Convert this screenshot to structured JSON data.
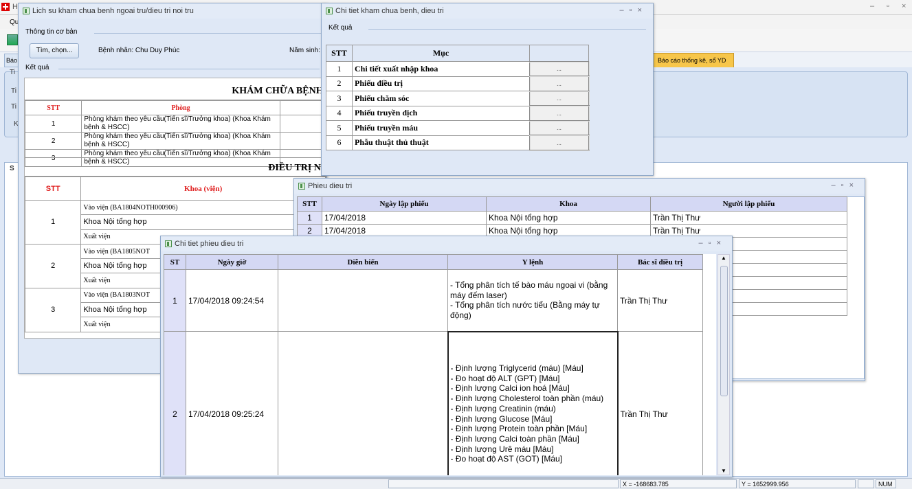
{
  "app": {
    "title_partial": "H",
    "menu_partial": "Qu",
    "window_controls": [
      "–",
      "▫",
      "×"
    ],
    "tab_left_partial": "Báo",
    "tab_baocao": "Báo cáo thống kê, sổ YD",
    "left_labels": [
      "Ti",
      "Ti",
      "Ti",
      "K",
      "S"
    ]
  },
  "status": {
    "x": "X = -168683.785",
    "y": "Y = 1652999.956",
    "num": "NUM"
  },
  "w1": {
    "title": "Lich su kham chua benh ngoai tru/dieu tri noi tru",
    "basic_label": "Thông tin cơ bản",
    "find_button": "Tìm, chọn...",
    "patient": "Bệnh nhân: Chu Duy Phúc",
    "dob_label": "Năm sinh:",
    "result_label": "Kết quả",
    "sec1": "KHÁM CHỮA BỆNH NGO",
    "sec1_headers": [
      "STT",
      "Phòng"
    ],
    "sec1_rows": [
      {
        "stt": "1",
        "room": "Phòng khám theo yêu cầu(Tiến sĩ/Trưởng khoa)  (Khoa Khám bệnh & HSCC)"
      },
      {
        "stt": "2",
        "room": "Phòng khám theo yêu cầu(Tiến sĩ/Trưởng khoa)  (Khoa Khám bệnh & HSCC)"
      },
      {
        "stt": "3",
        "room": "Phòng khám theo yêu cầu(Tiến sĩ/Trưởng khoa)  (Khoa Khám bệnh & HSCC)"
      }
    ],
    "sec2": "ĐIỀU TRỊ NỘI TR",
    "sec2_headers": [
      "STT",
      "Khoa (viện)"
    ],
    "sec2_rows": [
      {
        "stt": "1",
        "lines": [
          "Vào viện (BA1804NOTH000906)",
          "Khoa Nội tổng hợp",
          "Xuất viện"
        ]
      },
      {
        "stt": "2",
        "lines": [
          "Vào viện (BA1805NOT",
          "Khoa Nội tổng hợp",
          "Xuất viện"
        ]
      },
      {
        "stt": "3",
        "lines": [
          "Vào viện (BA1803NOT",
          "Khoa Nội tổng hợp",
          "Xuất viện"
        ]
      }
    ]
  },
  "w2": {
    "title": "Chi tiet kham chua benh, dieu tri",
    "result_label": "Kết quả",
    "headers": [
      "STT",
      "Mục",
      ""
    ],
    "rows": [
      {
        "stt": "1",
        "item": "Chi tiết xuất nhập khoa",
        "btn": "..."
      },
      {
        "stt": "2",
        "item": "Phiếu điều trị",
        "btn": "..."
      },
      {
        "stt": "3",
        "item": "Phiếu chăm sóc",
        "btn": "..."
      },
      {
        "stt": "4",
        "item": "Phiếu truyền dịch",
        "btn": "..."
      },
      {
        "stt": "5",
        "item": "Phiếu truyền máu",
        "btn": "..."
      },
      {
        "stt": "6",
        "item": "Phẫu thuật thủ thuật",
        "btn": "..."
      }
    ]
  },
  "w3": {
    "title": "Phieu dieu tri",
    "headers": [
      "STT",
      "Ngày lập phiếu",
      "Khoa",
      "Người lập phiếu"
    ],
    "rows": [
      {
        "stt": "1",
        "date": "17/04/2018",
        "dept": "Khoa Nội tổng hợp",
        "by": "Trần Thị Thư"
      },
      {
        "stt": "2",
        "date": "17/04/2018",
        "dept": "Khoa Nội tổng hợp",
        "by": "Trần Thị Thư"
      }
    ]
  },
  "w4": {
    "title": "Chi tiet phieu dieu tri",
    "headers": [
      "ST",
      "Ngày giờ",
      "Diễn biến",
      "Y lệnh",
      "Bác sĩ điều trị"
    ],
    "rows": [
      {
        "stt": "1",
        "time": "17/04/2018 09:24:54",
        "progress": "",
        "orders": [
          "- Tổng phân tích tế bào máu ngoại vi (bằng máy đếm laser)",
          "- Tổng phân tích nước tiểu (Bằng máy tự động)"
        ],
        "doctor": "Trần Thị Thư"
      },
      {
        "stt": "2",
        "time": "17/04/2018 09:25:24",
        "progress": "",
        "orders": [
          "- Định lượng Triglycerid (máu) [Máu]",
          "- Đo hoạt độ ALT (GPT) [Máu]",
          "- Định lượng Calci ion hoá [Máu]",
          "- Định lượng Cholesterol toàn phần (máu)",
          "- Định lượng Creatinin (máu)",
          "- Định lượng Glucose [Máu]",
          "- Định lượng Protein toàn phần [Máu]",
          "- Định lượng Calci toàn phần [Máu]",
          "- Định lượng Urê máu [Máu]",
          "- Đo hoạt độ AST (GOT) [Máu]"
        ],
        "doctor": "Trần Thị Thư"
      }
    ]
  }
}
